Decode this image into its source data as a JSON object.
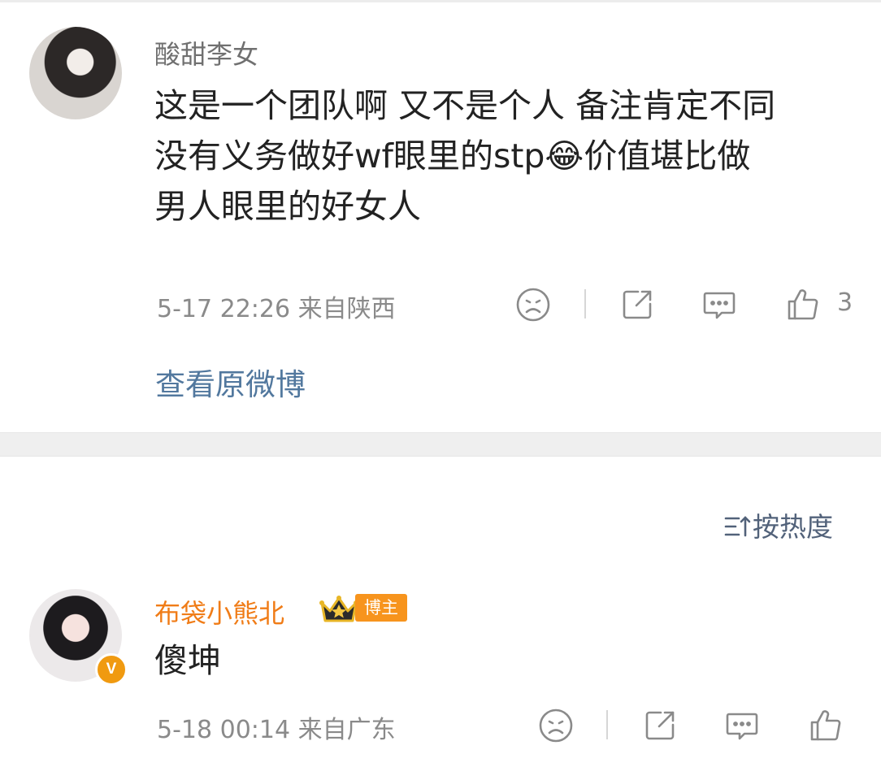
{
  "comments": [
    {
      "username": "酸甜李女",
      "content": "这是一个团队啊 又不是个人 备注肯定不同\n没有义务做好wf眼里的stp😂价值堪比做\n男人眼里的好女人",
      "time": "5-17 22:26",
      "location": "来自陕西",
      "likes": "3",
      "view_original": "查看原微博"
    },
    {
      "username": "布袋小熊北",
      "tag": "博主",
      "verified_badge": "V",
      "content": "傻坤",
      "time": "5-18 00:14",
      "location": "来自广东"
    }
  ],
  "sort": {
    "label": "按热度"
  },
  "icons": {
    "dislike": "sad-face-icon",
    "share": "share-icon",
    "comment": "comment-icon",
    "like": "thumbs-up-icon",
    "sort": "sort-icon"
  },
  "colors": {
    "username": "#707070",
    "blogger_name": "#f07c17",
    "link": "#52789e",
    "meta": "#8a8a8a",
    "tag_bg": "#f7941d"
  }
}
